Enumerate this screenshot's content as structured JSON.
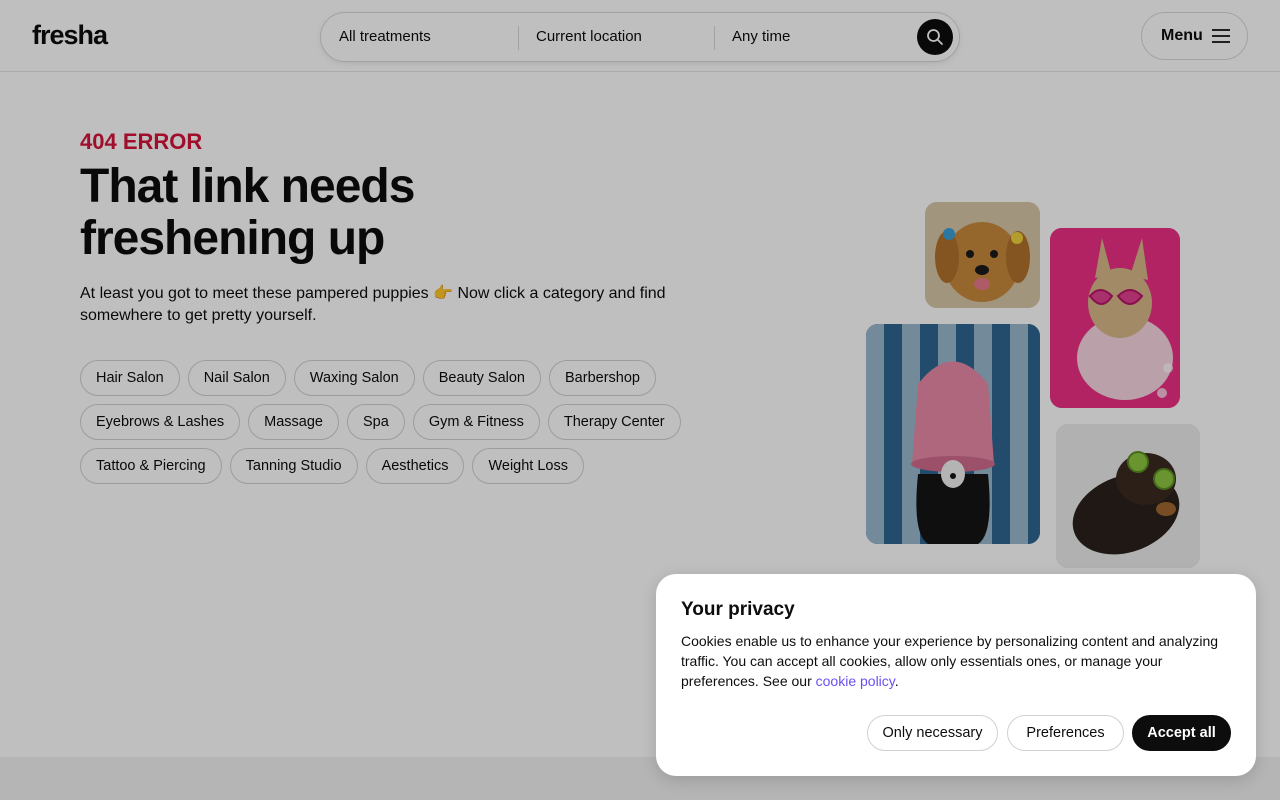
{
  "header": {
    "logo": "fresha",
    "search": {
      "treatments": "All treatments",
      "location": "Current location",
      "time": "Any time"
    },
    "menu_label": "Menu"
  },
  "main": {
    "error_code": "404 ERROR",
    "headline": "That link needs freshening up",
    "subtitle": "At least you got to meet these pampered puppies 👉 Now click a category and find somewhere to get pretty yourself.",
    "categories": [
      [
        "Hair Salon",
        "Nail Salon",
        "Waxing Salon",
        "Beauty Salon",
        "Barbershop"
      ],
      [
        "Eyebrows & Lashes",
        "Massage",
        "Spa",
        "Gym & Fitness",
        "Therapy Center"
      ],
      [
        "Tattoo & Piercing",
        "Tanning Studio",
        "Aesthetics",
        "Weight Loss"
      ]
    ]
  },
  "cookie": {
    "title": "Your privacy",
    "text": "Cookies enable us to enhance your experience by personalizing content and analyzing traffic. You can accept all cookies, allow only essentials ones, or manage your preferences. See our ",
    "link": "cookie policy",
    "text_end": ".",
    "buttons": {
      "necessary": "Only necessary",
      "preferences": "Preferences",
      "accept": "Accept all"
    }
  }
}
